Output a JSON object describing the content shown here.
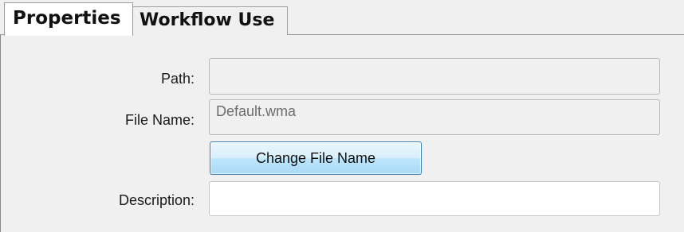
{
  "tabs": {
    "properties": "Properties",
    "workflow_use": "Workflow Use"
  },
  "form": {
    "path_label": "Path:",
    "path_value": "",
    "file_name_label": "File Name:",
    "file_name_value": "Default.wma",
    "change_button_label": "Change File Name",
    "description_label": "Description:",
    "description_value": ""
  }
}
